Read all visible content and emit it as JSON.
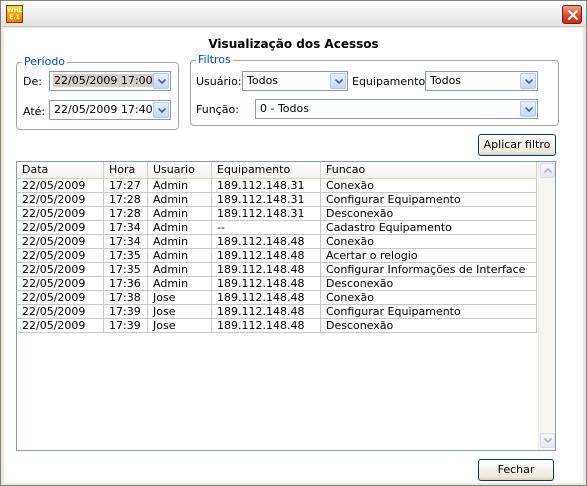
{
  "window": {
    "icon_lines": [
      "WHL",
      "E.1"
    ]
  },
  "form": {
    "title": "Visualização dos Acessos"
  },
  "periodo": {
    "legend": "Período",
    "de_label": "De:",
    "de_value": "22/05/2009 17:00",
    "ate_label": "Até:",
    "ate_value": "22/05/2009 17:40"
  },
  "filtros": {
    "legend": "Filtros",
    "usuario_label": "Usuário:",
    "usuario_value": "Todos",
    "equipamento_label": "Equipamento:",
    "equipamento_value": "Todos",
    "funcao_label": "Função:",
    "funcao_value": "0 -  Todos"
  },
  "buttons": {
    "aplicar": "Aplicar filtro",
    "fechar": "Fechar"
  },
  "table": {
    "columns": [
      "Data",
      "Hora",
      "Usuario",
      "Equipamento",
      "Funcao"
    ],
    "rows": [
      [
        "22/05/2009",
        "17:27",
        "Admin",
        "189.112.148.31",
        "Conexão"
      ],
      [
        "22/05/2009",
        "17:28",
        "Admin",
        "189.112.148.31",
        "Configurar Equipamento"
      ],
      [
        "22/05/2009",
        "17:28",
        "Admin",
        "189.112.148.31",
        "Desconexão"
      ],
      [
        "22/05/2009",
        "17:34",
        "Admin",
        "--",
        "Cadastro Equipamento"
      ],
      [
        "22/05/2009",
        "17:34",
        "Admin",
        "189.112.148.48",
        "Conexão"
      ],
      [
        "22/05/2009",
        "17:35",
        "Admin",
        "189.112.148.48",
        "Acertar o relogio"
      ],
      [
        "22/05/2009",
        "17:35",
        "Admin",
        "189.112.148.48",
        "Configurar Informações de Interface"
      ],
      [
        "22/05/2009",
        "17:36",
        "Admin",
        "189.112.148.48",
        "Desconexão"
      ],
      [
        "22/05/2009",
        "17:38",
        "Jose",
        "189.112.148.48",
        "Conexão"
      ],
      [
        "22/05/2009",
        "17:39",
        "Jose",
        "189.112.148.48",
        "Configurar Equipamento"
      ],
      [
        "22/05/2009",
        "17:39",
        "Jose",
        "189.112.148.48",
        "Desconexão"
      ]
    ]
  },
  "colors": {
    "legend_text": "#0046d5",
    "close_button": "#d8492a",
    "window_bg": "#ece9d8"
  }
}
